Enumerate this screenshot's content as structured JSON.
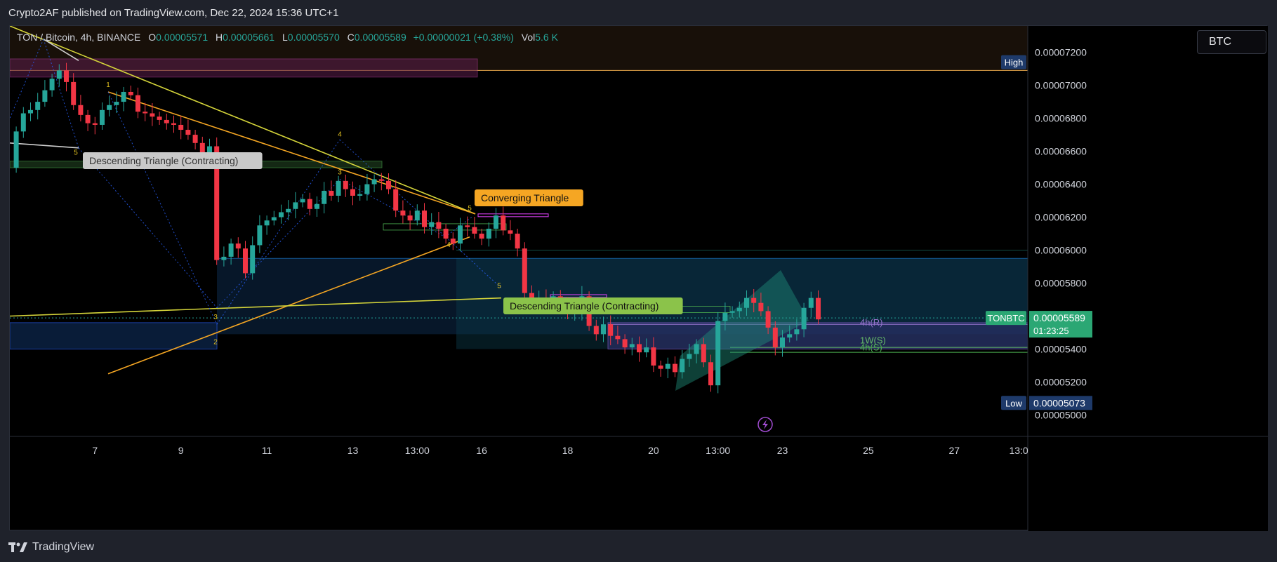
{
  "header": {
    "publish_line": "Crypto2AF published on TradingView.com, Dec 22, 2024 15:36 UTC+1"
  },
  "legend": {
    "symbol": "TON / Bitcoin, 4h, BINANCE",
    "open_label": "O",
    "open": "0.00005571",
    "high_label": "H",
    "high": "0.00005661",
    "low_label": "L",
    "low": "0.00005570",
    "close_label": "C",
    "close": "0.00005589",
    "change": "+0.00000021 (+0.38%)",
    "vol_label": "Vol",
    "vol": "5.6 K"
  },
  "currency_button": "BTC",
  "footer": {
    "brand": "TradingView"
  },
  "colors": {
    "up": "#26a69a",
    "down": "#f23645",
    "background": "#000000",
    "axis_text": "#d1d4dc",
    "yellow_line": "#d4d43a",
    "orange_line": "#f5a623",
    "blue_zone": "#0d2a4a",
    "magenta_zone": "#5c1e4c",
    "brown_zone": "#2c1e10",
    "green_label": "#8bc34a",
    "orange_label": "#f5a623",
    "price_tag": "#2ba774"
  },
  "chart_data": {
    "type": "candlestick",
    "timeframe": "4h",
    "y_axis": {
      "position": "right",
      "tick_labels": [
        "0.00007200",
        "0.00007000",
        "0.00006800",
        "0.00006600",
        "0.00006400",
        "0.00006200",
        "0.00006000",
        "0.00005800",
        "0.00005600",
        "0.00005400",
        "0.00005200",
        "0.00005000"
      ],
      "ylim": [
        4.87e-05,
        7.36e-05
      ]
    },
    "x_axis": {
      "tick_labels": [
        "7",
        "9",
        "11",
        "13",
        "13:00",
        "16",
        "18",
        "20",
        "13:00",
        "23",
        "25",
        "27",
        "13:0"
      ],
      "tick_index": [
        11,
        23,
        35,
        47,
        56,
        65,
        77,
        89,
        98,
        107,
        119,
        131,
        140
      ]
    },
    "price_tags": {
      "high": {
        "label": "High",
        "value": 7.14e-05
      },
      "low": {
        "label": "Low",
        "value": 5.073e-05,
        "text": "0.00005073"
      },
      "current": {
        "symbol": "TONBTC",
        "value": 5.589e-05,
        "text": "0.00005589",
        "countdown": "01:23:25"
      }
    },
    "candles_close": [
      6.72e-05,
      6.83e-05,
      6.85e-05,
      6.9e-05,
      6.97e-05,
      7.04e-05,
      7.09e-05,
      7.02e-05,
      6.88e-05,
      6.82e-05,
      6.77e-05,
      6.76e-05,
      6.85e-05,
      6.88e-05,
      6.9e-05,
      6.96e-05,
      6.94e-05,
      6.84e-05,
      6.83e-05,
      6.81e-05,
      6.79e-05,
      6.77e-05,
      6.76e-05,
      6.73e-05,
      6.7e-05,
      6.65e-05,
      6.58e-05,
      6.63e-05,
      5.94e-05,
      5.96e-05,
      6.04e-05,
      6.01e-05,
      5.86e-05,
      6.03e-05,
      6.15e-05,
      6.18e-05,
      6.2e-05,
      6.23e-05,
      6.25e-05,
      6.29e-05,
      6.31e-05,
      6.25e-05,
      6.28e-05,
      6.36e-05,
      6.33e-05,
      6.42e-05,
      6.37e-05,
      6.33e-05,
      6.34e-05,
      6.4e-05,
      6.43e-05,
      6.42e-05,
      6.37e-05,
      6.24e-05,
      6.21e-05,
      6.18e-05,
      6.24e-05,
      6.14e-05,
      6.17e-05,
      6.13e-05,
      6.07e-05,
      6.04e-05,
      6.15e-05,
      6.14e-05,
      6.1e-05,
      6.07e-05,
      6.13e-05,
      6.21e-05,
      6.12e-05,
      6.1e-05,
      6.01e-05,
      5.74e-05,
      5.65e-05,
      5.7e-05,
      5.69e-05,
      5.72e-05,
      5.67e-05,
      5.62e-05,
      5.63e-05,
      5.72e-05,
      5.54e-05,
      5.49e-05,
      5.55e-05,
      5.48e-05,
      5.46e-05,
      5.41e-05,
      5.43e-05,
      5.38e-05,
      5.41e-05,
      5.3e-05,
      5.28e-05,
      5.31e-05,
      5.26e-05,
      5.34e-05,
      5.37e-05,
      5.43e-05,
      5.32e-05,
      5.18e-05,
      5.57e-05,
      5.62e-05,
      5.63e-05,
      5.65e-05,
      5.71e-05,
      5.68e-05,
      5.63e-05,
      5.53e-05,
      5.41e-05,
      5.47e-05,
      5.49e-05,
      5.52e-05,
      5.65e-05,
      5.71e-05,
      5.58e-05
    ],
    "candles_open": [
      6.5e-05,
      6.72e-05,
      6.83e-05,
      6.85e-05,
      6.9e-05,
      6.97e-05,
      7.04e-05,
      7.09e-05,
      7.02e-05,
      6.88e-05,
      6.82e-05,
      6.77e-05,
      6.76e-05,
      6.85e-05,
      6.88e-05,
      6.9e-05,
      6.96e-05,
      6.94e-05,
      6.84e-05,
      6.83e-05,
      6.81e-05,
      6.79e-05,
      6.77e-05,
      6.76e-05,
      6.73e-05,
      6.7e-05,
      6.65e-05,
      6.58e-05,
      6.63e-05,
      5.94e-05,
      5.96e-05,
      6.04e-05,
      6.01e-05,
      5.86e-05,
      6.03e-05,
      6.15e-05,
      6.18e-05,
      6.2e-05,
      6.23e-05,
      6.25e-05,
      6.29e-05,
      6.31e-05,
      6.25e-05,
      6.28e-05,
      6.36e-05,
      6.33e-05,
      6.42e-05,
      6.37e-05,
      6.33e-05,
      6.34e-05,
      6.4e-05,
      6.43e-05,
      6.42e-05,
      6.37e-05,
      6.24e-05,
      6.21e-05,
      6.18e-05,
      6.24e-05,
      6.14e-05,
      6.17e-05,
      6.13e-05,
      6.07e-05,
      6.04e-05,
      6.15e-05,
      6.14e-05,
      6.1e-05,
      6.07e-05,
      6.13e-05,
      6.21e-05,
      6.12e-05,
      6.1e-05,
      6.01e-05,
      5.74e-05,
      5.65e-05,
      5.7e-05,
      5.69e-05,
      5.72e-05,
      5.67e-05,
      5.62e-05,
      5.63e-05,
      5.72e-05,
      5.54e-05,
      5.49e-05,
      5.55e-05,
      5.48e-05,
      5.46e-05,
      5.41e-05,
      5.43e-05,
      5.38e-05,
      5.41e-05,
      5.3e-05,
      5.28e-05,
      5.31e-05,
      5.26e-05,
      5.34e-05,
      5.37e-05,
      5.43e-05,
      5.32e-05,
      5.18e-05,
      5.57e-05,
      5.62e-05,
      5.63e-05,
      5.65e-05,
      5.71e-05,
      5.68e-05,
      5.63e-05,
      5.53e-05,
      5.41e-05,
      5.47e-05,
      5.49e-05,
      5.52e-05,
      5.65e-05,
      5.71e-05
    ],
    "annotations": [
      {
        "text": "Descending Triangle (Contracting)",
        "style": "gray"
      },
      {
        "text": "Converging Triangle",
        "style": "orange"
      },
      {
        "text": "Descending Triangle (Contracting)",
        "style": "green"
      },
      {
        "text": "4h(R)",
        "style": "purple"
      },
      {
        "text": "4h(S)",
        "style": "green"
      },
      {
        "text": "1W(S)",
        "style": "green"
      }
    ],
    "pattern_point_labels": [
      "1",
      "2",
      "3",
      "4",
      "5"
    ]
  }
}
